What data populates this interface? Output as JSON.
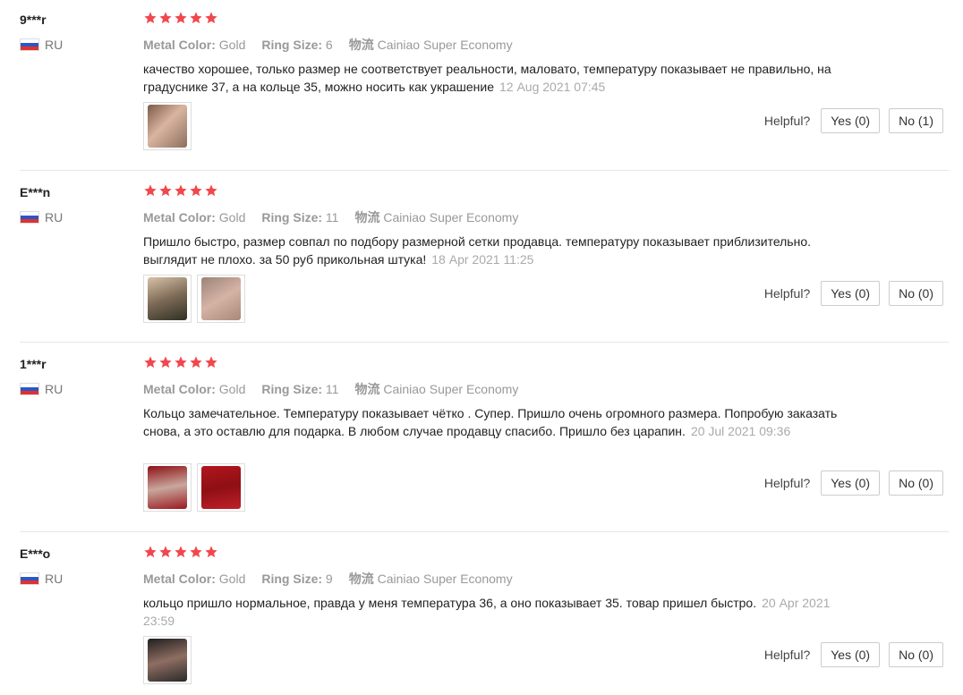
{
  "labels": {
    "metal_color": "Metal Color:",
    "ring_size": "Ring Size:",
    "shipping": "物流",
    "helpful": "Helpful?"
  },
  "reviews": [
    {
      "user": "9***r",
      "country": "RU",
      "rating": 5,
      "metal_color": "Gold",
      "ring_size": "6",
      "shipping": "Cainiao Super Economy",
      "text": "качество хорошее, только размер не соответствует реальности, маловато, температуру показывает не правильно, на градуснике 37, а на кольце 35, можно носить как украшение",
      "date": "12 Aug 2021 07:45",
      "yes": "Yes (0)",
      "no": "No (1)"
    },
    {
      "user": "E***n",
      "country": "RU",
      "rating": 5,
      "metal_color": "Gold",
      "ring_size": "11",
      "shipping": "Cainiao Super Economy",
      "text": "Пришло быстро, размер совпал по подбору размерной сетки продавца. температуру показывает приблизительно. выглядит не плохо. за 50 руб прикольная штука!",
      "date": "18 Apr 2021 11:25",
      "yes": "Yes (0)",
      "no": "No (0)"
    },
    {
      "user": "1***r",
      "country": "RU",
      "rating": 5,
      "metal_color": "Gold",
      "ring_size": "11",
      "shipping": "Cainiao Super Economy",
      "text": "Кольцо замечательное. Температуру показывает чётко . Супер. Пришло очень огромного размера. Попробую заказать снова, а это оставлю для подарка. В любом случае продавцу спасибо. Пришло без царапин.",
      "date": "20 Jul 2021 09:36",
      "yes": "Yes (0)",
      "no": "No (0)"
    },
    {
      "user": "E***o",
      "country": "RU",
      "rating": 5,
      "metal_color": "Gold",
      "ring_size": "9",
      "shipping": "Cainiao Super Economy",
      "text": "кольцо пришло нормальное, правда у меня температура 36, а оно показывает 35. товар пришел быстро.",
      "date": "20 Apr 2021 23:59",
      "yes": "Yes (0)",
      "no": "No (0)"
    }
  ],
  "colors": {
    "star": "#f0484d",
    "date": "#aaaaaa"
  }
}
